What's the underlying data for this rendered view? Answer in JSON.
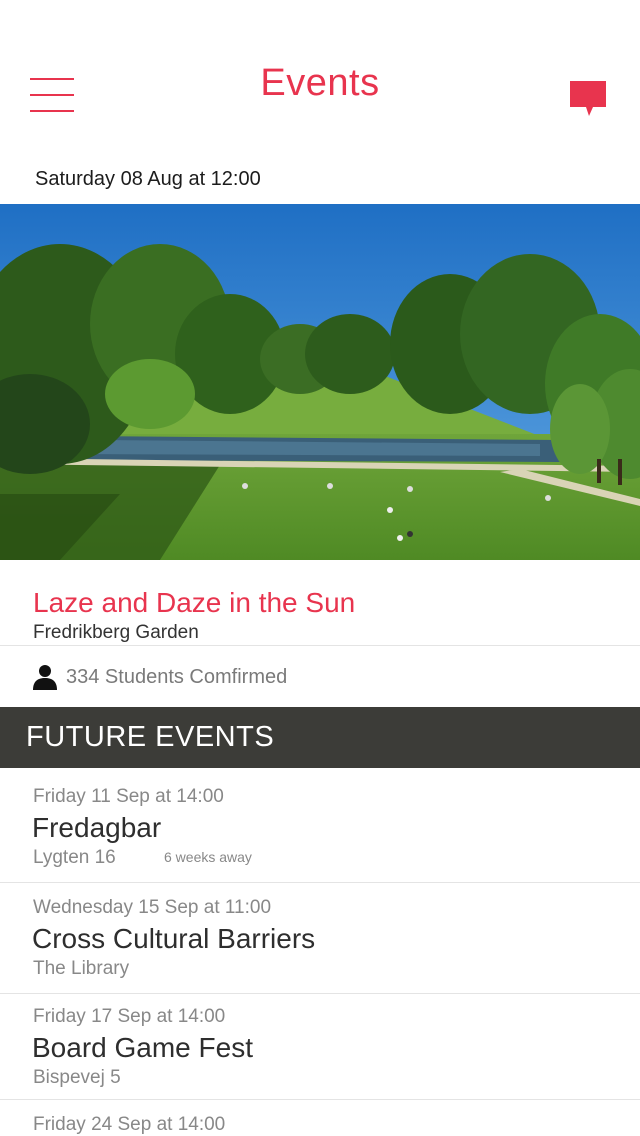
{
  "header": {
    "title": "Events",
    "menu_icon": "hamburger-menu-icon",
    "chat_icon": "chat-bubble-icon"
  },
  "colors": {
    "accent": "#e8344e",
    "section_bar": "#3c3c38"
  },
  "featured": {
    "date": "Saturday 08 Aug at 12:00",
    "image": "park-lawn-photo",
    "title": "Laze and Daze in the Sun",
    "venue": "Fredrikberg Garden",
    "confirmed_icon": "person-icon",
    "confirmed": "334 Students Comfirmed"
  },
  "future": {
    "heading": "FUTURE EVENTS",
    "events": [
      {
        "date": "Friday 11 Sep at 14:00",
        "name": "Fredagbar",
        "venue": "Lygten 16",
        "away": "6 weeks away"
      },
      {
        "date": "Wednesday 15 Sep at 11:00",
        "name": "Cross Cultural Barriers",
        "venue": "The Library",
        "away": ""
      },
      {
        "date": "Friday 17 Sep at 14:00",
        "name": "Board Game Fest",
        "venue": "Bispevej 5",
        "away": ""
      },
      {
        "date": "Friday 24 Sep at 14:00",
        "name": "",
        "venue": "",
        "away": ""
      }
    ]
  }
}
